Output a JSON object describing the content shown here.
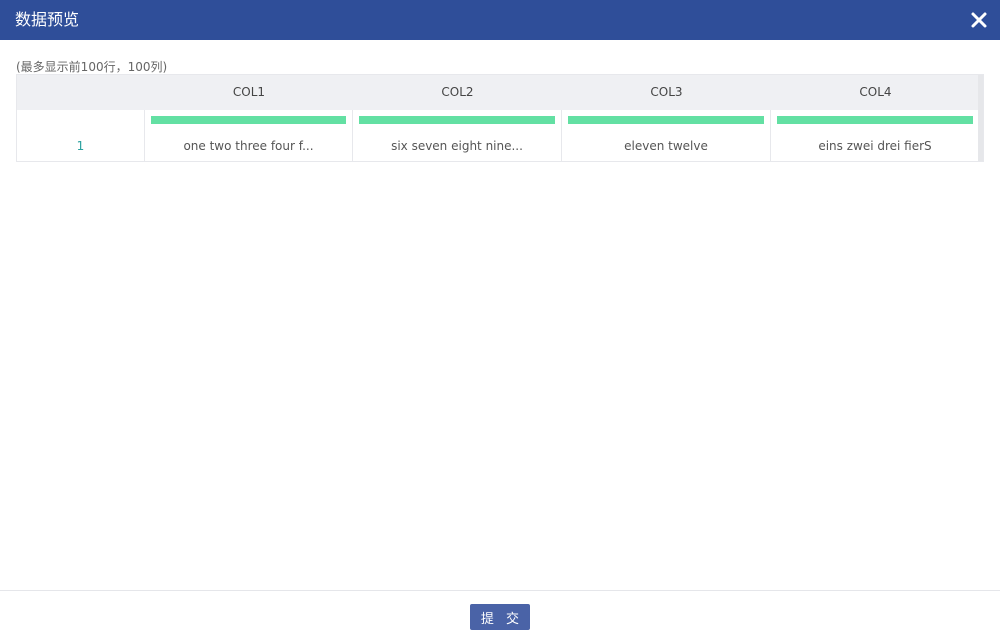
{
  "dialog": {
    "title": "数据预览",
    "close_icon": "close-icon",
    "note": "(最多显示前100行，100列)",
    "submit_label": "提 交"
  },
  "table": {
    "columns": [
      "COL1",
      "COL2",
      "COL3",
      "COL4"
    ],
    "rows": [
      {
        "index": "1",
        "cells": [
          "one two three four f...",
          "six seven eight nine...",
          "eleven twelve",
          "eins zwei drei fierS"
        ]
      }
    ]
  },
  "colors": {
    "title_bar": "#2f4e99",
    "submit_button": "#4a63a7",
    "completeness_bar": "#63e0a3",
    "row_index": "#2aa19f"
  }
}
